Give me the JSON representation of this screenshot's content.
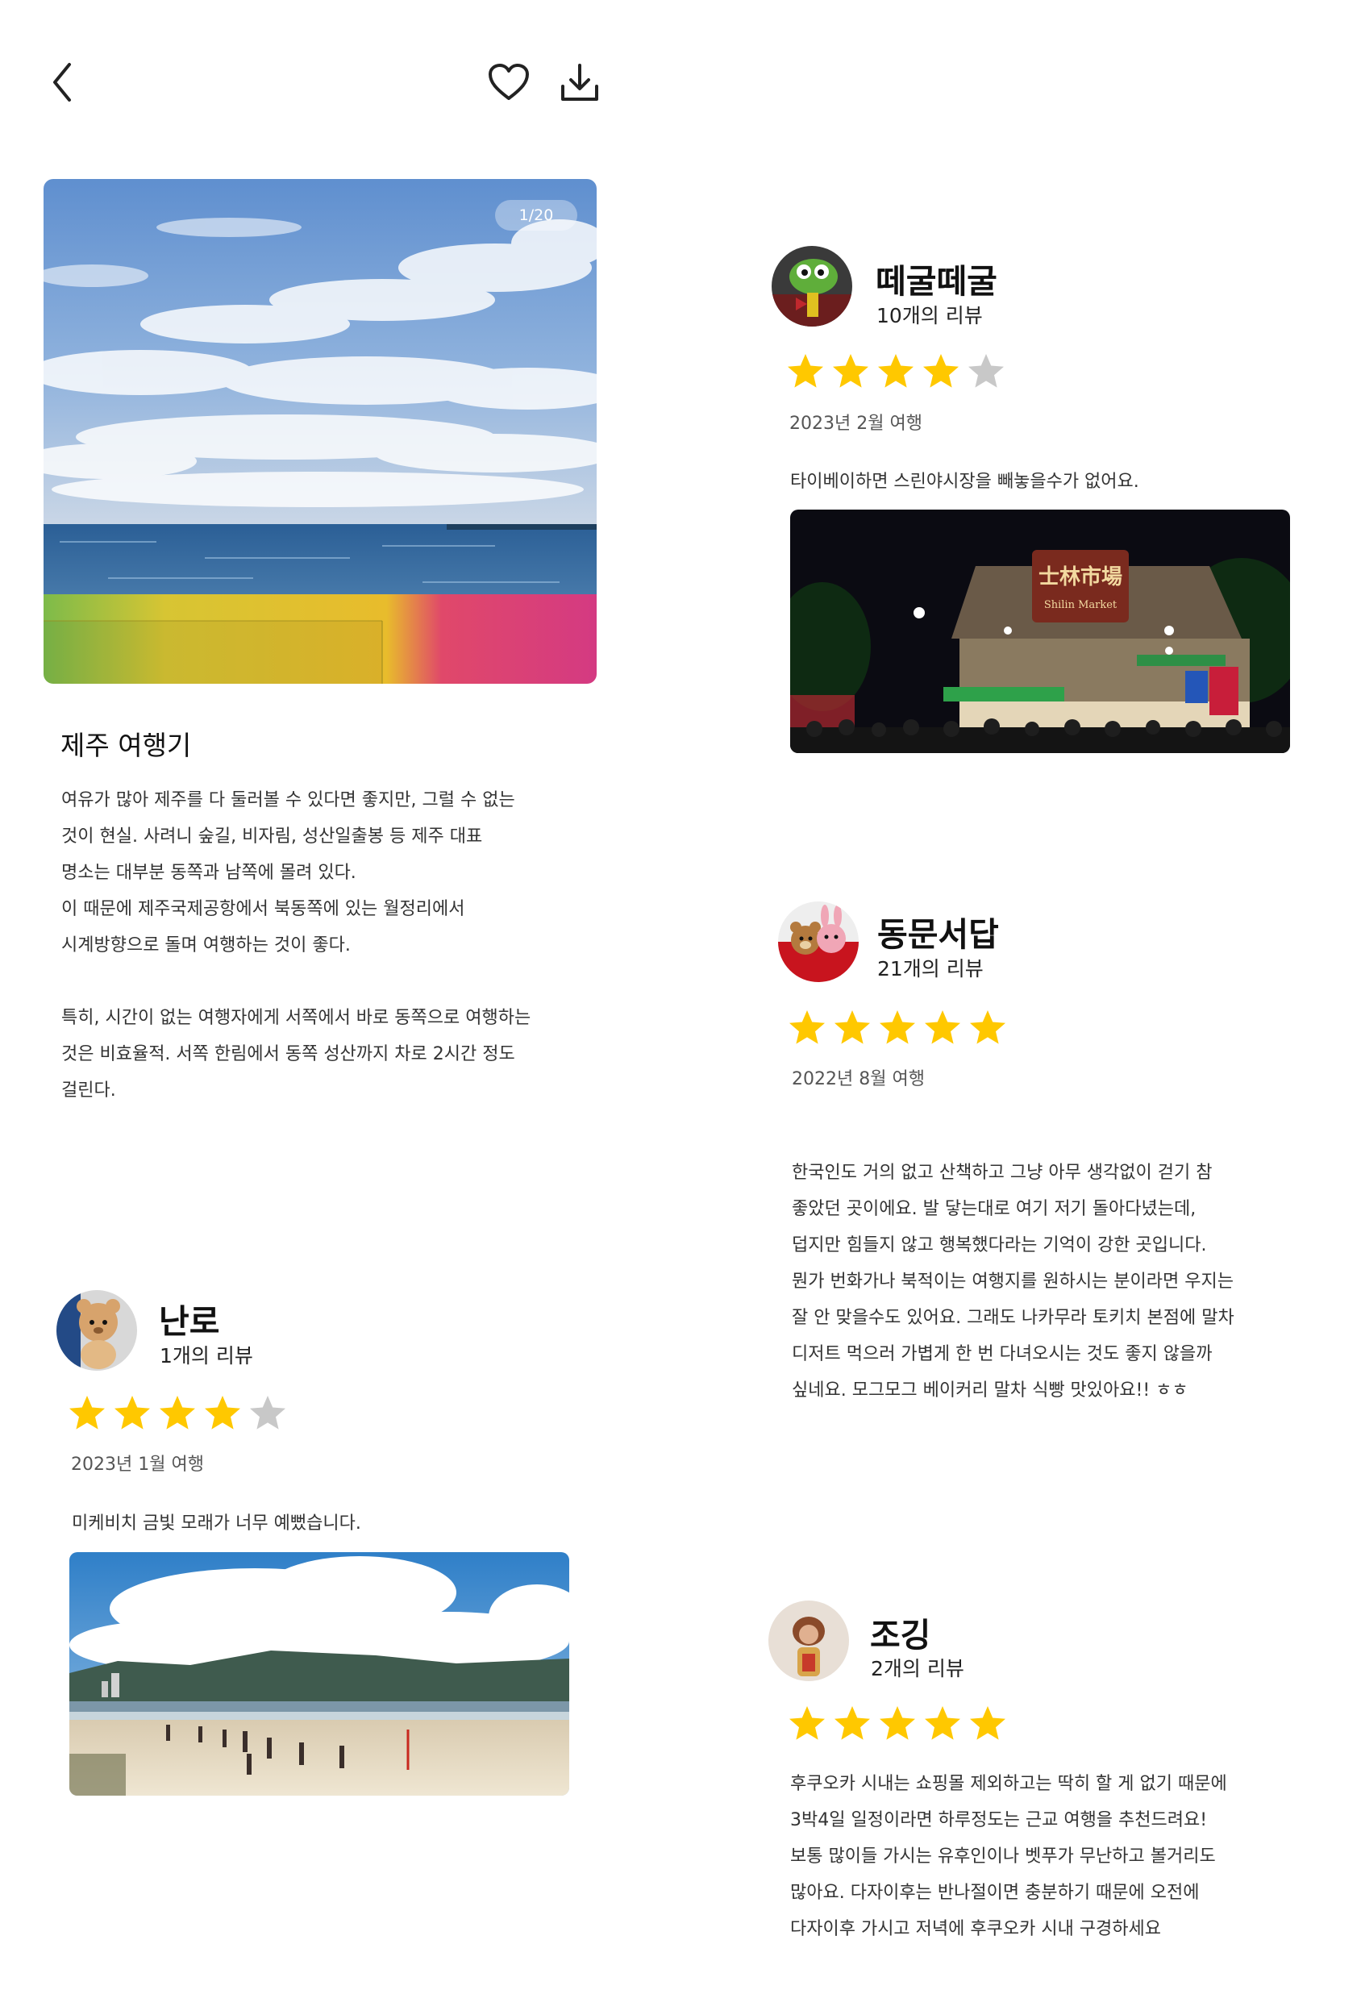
{
  "header": {
    "back_icon": "chevron-left-icon",
    "like_icon": "heart-icon",
    "download_icon": "download-icon"
  },
  "article": {
    "page_indicator": "1/20",
    "title": "제주 여행기",
    "paragraph_1": "여유가 많아 제주를 다 둘러볼 수 있다면 좋지만, 그럴 수 없는\n것이 현실. 사려니 숲길, 비자림, 성산일출봉 등 제주 대표\n명소는 대부분 동쪽과 남쪽에 몰려 있다.\n이 때문에 제주국제공항에서 북동쪽에 있는 월정리에서\n시계방향으로 돌며 여행하는 것이 좋다.",
    "paragraph_2": " 특히, 시간이 없는 여행자에게 서쪽에서 바로 동쪽으로 여행하는\n것은 비효율적. 서쪽 한림에서 동쪽 성산까지 차로 2시간 정도\n걸린다."
  },
  "colors": {
    "star_filled": "#FFC800",
    "star_empty": "#C8C8C8"
  },
  "reviews": [
    {
      "name": "떼굴떼굴",
      "review_count": "10개의 리뷰",
      "rating": 4,
      "trip_date": "2023년 2월 여행",
      "text": "타이베이하면 스린야시장을 빼놓을수가 없어요."
    },
    {
      "name": "동문서답",
      "review_count": "21개의 리뷰",
      "rating": 5,
      "trip_date": "2022년 8월 여행",
      "text": "한국인도 거의 없고 산책하고 그냥 아무 생각없이 걷기 참\n좋았던 곳이에요. 발 닿는대로 여기 저기 돌아다녔는데,\n덥지만 힘들지 않고 행복했다라는 기억이 강한 곳입니다.\n뭔가 번화가나 북적이는 여행지를 원하시는 분이라면 우지는\n잘 안 맞을수도 있어요. 그래도 나카무라 토키치 본점에 말차\n디저트 먹으러 가볍게 한 번 다녀오시는 것도 좋지 않을까\n싶네요. 모그모그 베이커리 말차 식빵 맛있아요!! ㅎㅎ"
    },
    {
      "name": "난로",
      "review_count": "1개의 리뷰",
      "rating": 4,
      "trip_date": "2023년 1월 여행",
      "text": "미케비치 금빛 모래가 너무 예뻤습니다."
    },
    {
      "name": "조깅",
      "review_count": "2개의 리뷰",
      "rating": 5,
      "trip_date": "",
      "text": "후쿠오카 시내는 쇼핑몰 제외하고는 딱히 할 게 없기 때문에\n3박4일 일정이라면 하루정도는 근교 여행을 추천드려요!\n보통 많이들 가시는 유후인이나 벳푸가 무난하고 볼거리도\n많아요. 다자이후는 반나절이면 충분하기 때문에 오전에\n다자이후 가시고 저녁에 후쿠오카 시내 구경하세요"
    }
  ],
  "market_sign": {
    "main": "士林市場",
    "sub": "Shilin Market"
  }
}
